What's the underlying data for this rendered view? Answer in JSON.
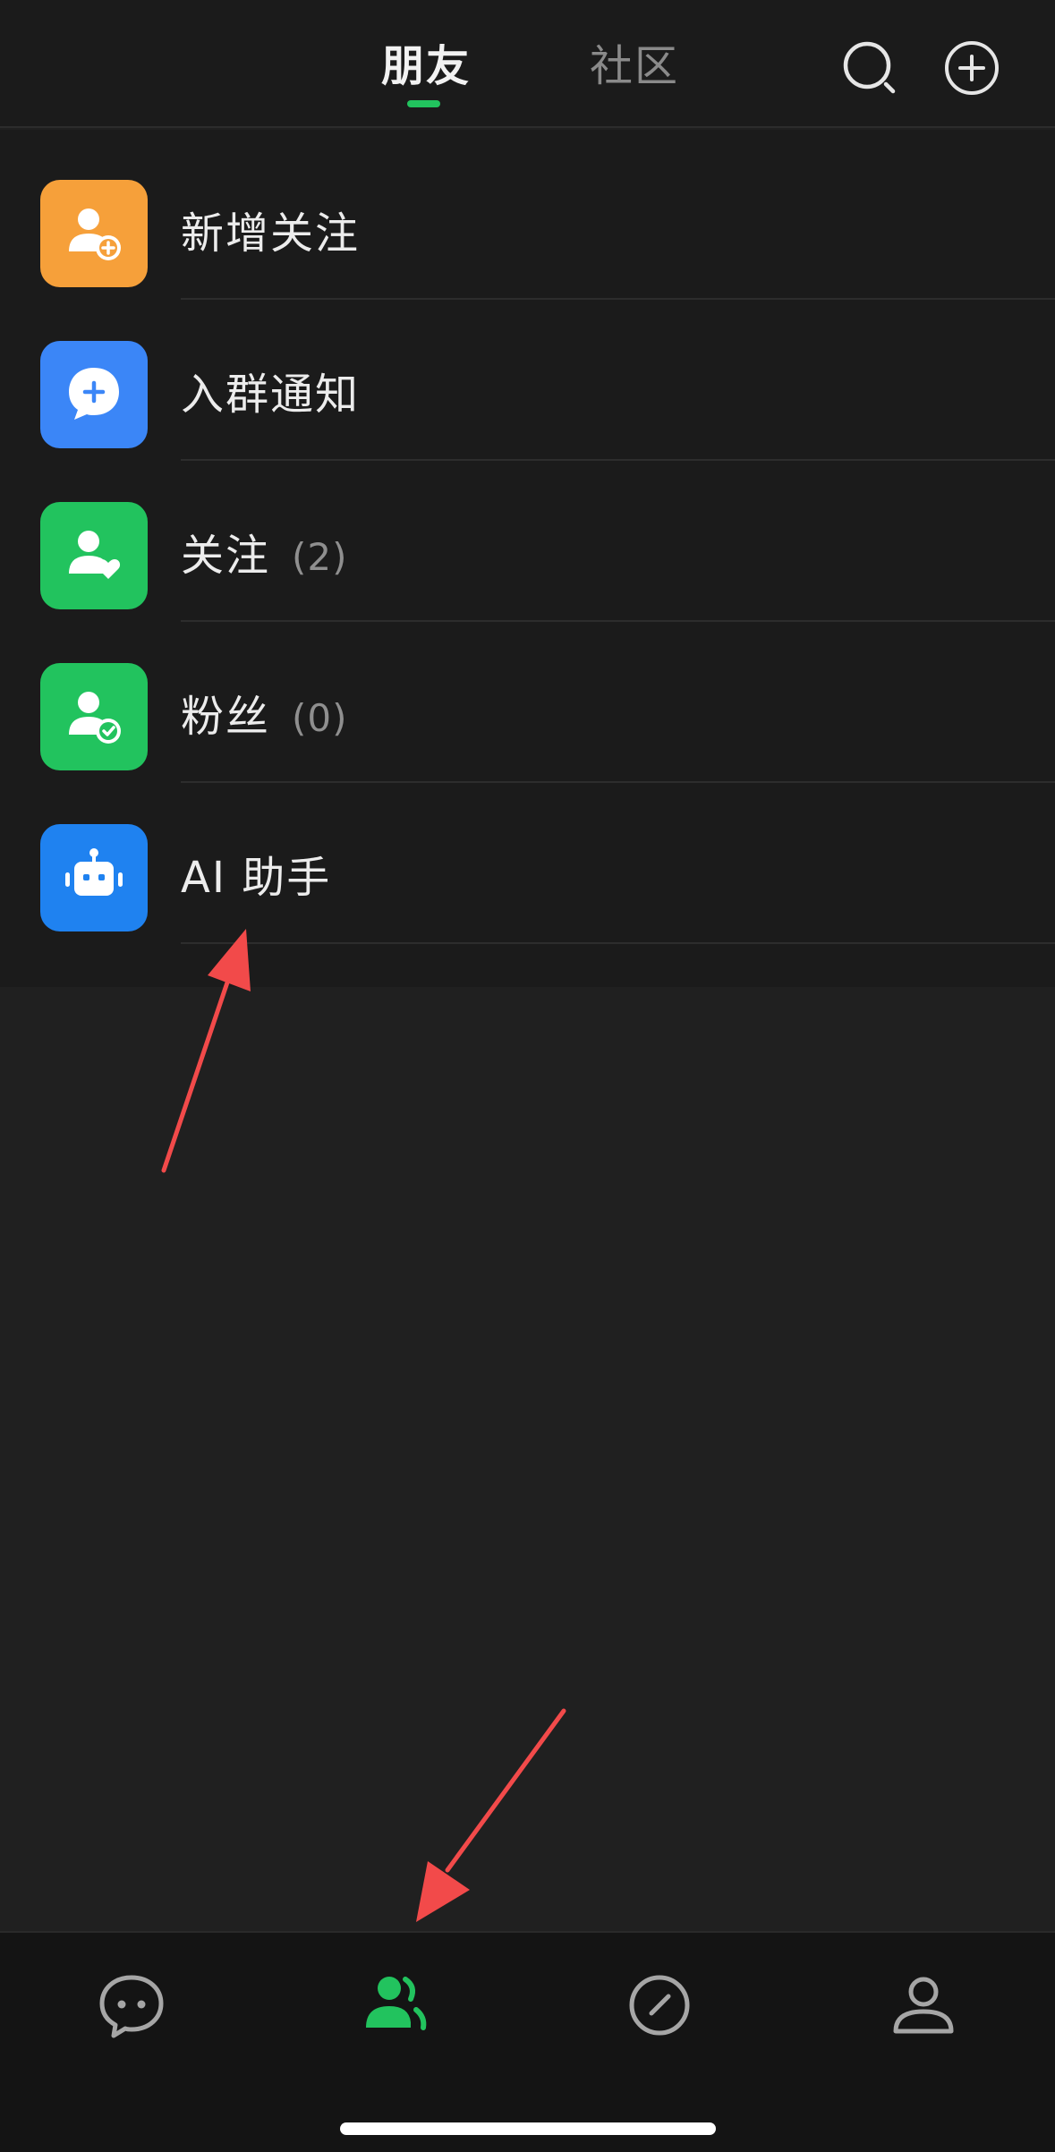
{
  "header": {
    "tabs": [
      {
        "label": "朋友",
        "active": true
      },
      {
        "label": "社区",
        "active": false
      }
    ],
    "icons": [
      "search-icon",
      "add-circle-icon"
    ],
    "accent_color": "#22c35e"
  },
  "list": {
    "items": [
      {
        "label": "新增关注",
        "count": "",
        "icon": "add-user-icon",
        "color": "#f6a03a"
      },
      {
        "label": "入群通知",
        "count": "",
        "icon": "chat-plus-icon",
        "color": "#3b86f7"
      },
      {
        "label": "关注",
        "count": "(2)",
        "icon": "user-heart-icon",
        "color": "#22c35e"
      },
      {
        "label": "粉丝",
        "count": "(0)",
        "icon": "user-check-icon",
        "color": "#22c35e"
      },
      {
        "label": "AI 助手",
        "count": "",
        "icon": "robot-icon",
        "color": "#1f82f0"
      }
    ]
  },
  "bottom_nav": {
    "items": [
      {
        "icon": "chat-icon",
        "active": false
      },
      {
        "icon": "friends-icon",
        "active": true
      },
      {
        "icon": "discover-icon",
        "active": false
      },
      {
        "icon": "profile-icon",
        "active": false
      }
    ]
  },
  "annotations": {
    "arrow_color": "#f24a4a"
  }
}
